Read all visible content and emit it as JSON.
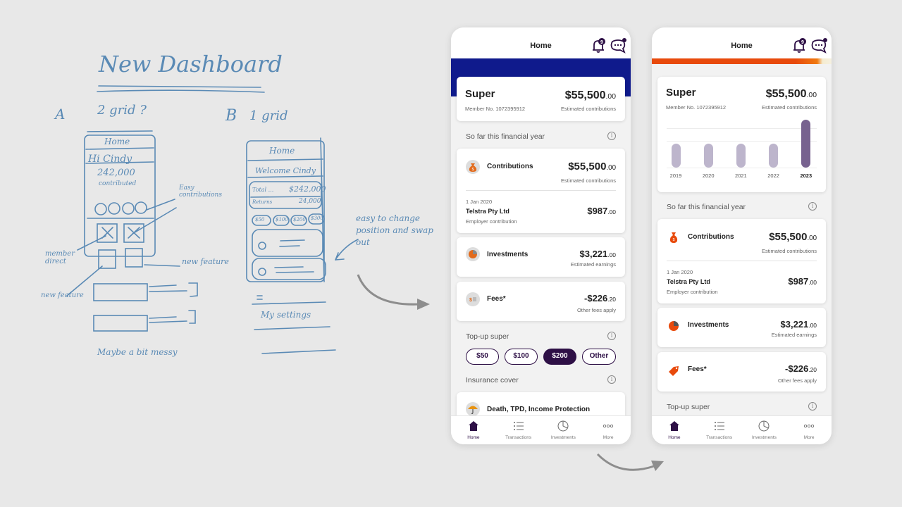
{
  "sketch": {
    "title": "New Dashboard",
    "option_a_label": "A",
    "option_a_desc": "2 grid ?",
    "option_b_label": "B",
    "option_b_desc": "1 grid",
    "a_phone": {
      "header": "Home",
      "greeting": "Hi Cindy",
      "amount": "242,000",
      "amount_caption": "contributed"
    },
    "b_phone": {
      "header": "Home",
      "greeting": "Welcome Cindy",
      "total_label": "Total ...",
      "total_value": "$242,000",
      "returns_label": "Returns",
      "returns_value": "24,000",
      "pills": [
        "$50",
        "$100",
        "$200",
        "$300"
      ],
      "settings": "My settings"
    },
    "annotations": {
      "easy_contributions": "Easy contributions",
      "member_direct": "member direct",
      "new_feature_1": "new feature",
      "new_feature_2": "new feature",
      "maybe_messy": "Maybe a bit messy",
      "easy_change": "easy to change position and swap out"
    }
  },
  "phones": [
    {
      "variant": "navy",
      "header": {
        "title": "Home",
        "notification_count": "9"
      },
      "accent_band_color": "#0f1a8c",
      "super": {
        "title": "Super",
        "member_no": "Member No. 1072395912",
        "amount_main": "$55,500",
        "amount_cents": ".00",
        "amount_caption": "Estimated contributions"
      },
      "section_financial": "So far this financial year",
      "contributions": {
        "label": "Contributions",
        "amount_main": "$55,500",
        "amount_cents": ".00",
        "caption": "Estimated contributions",
        "tx_date": "1 Jan 2020",
        "tx_name": "Telstra Pty Ltd",
        "tx_type": "Employer contribution",
        "tx_amount_main": "$987",
        "tx_amount_cents": ".00"
      },
      "investments": {
        "label": "Investments",
        "amount_main": "$3,221",
        "amount_cents": ".00",
        "caption": "Estimated earnings"
      },
      "fees": {
        "label": "Fees*",
        "amount_main": "-$226",
        "amount_cents": ".20",
        "caption": "Other fees apply"
      },
      "section_topup": "Top-up super",
      "topup_options": [
        {
          "label": "$50",
          "selected": false
        },
        {
          "label": "$100",
          "selected": false
        },
        {
          "label": "$200",
          "selected": true
        },
        {
          "label": "Other",
          "selected": false
        }
      ],
      "section_insurance": "Insurance cover",
      "insurance": {
        "label": "Death, TPD, Income Protection"
      },
      "tabs": [
        {
          "label": "Home",
          "icon": "home-icon",
          "active": true
        },
        {
          "label": "Transactions",
          "icon": "list-icon",
          "active": false
        },
        {
          "label": "Investments",
          "icon": "pie-chart-icon",
          "active": false
        },
        {
          "label": "More",
          "icon": "more-icon",
          "active": false
        }
      ]
    },
    {
      "variant": "orange",
      "header": {
        "title": "Home",
        "notification_count": "9"
      },
      "accent_band_color": "#e84a0c",
      "super": {
        "title": "Super",
        "member_no": "Member No. 1072395912",
        "amount_main": "$55,500",
        "amount_cents": ".00",
        "amount_caption": "Estimated contributions"
      },
      "section_financial": "So far this financial year",
      "contributions": {
        "label": "Contributions",
        "amount_main": "$55,500",
        "amount_cents": ".00",
        "caption": "Estimated contributions",
        "tx_date": "1 Jan 2020",
        "tx_name": "Telstra Pty Ltd",
        "tx_type": "Employer contribution",
        "tx_amount_main": "$987",
        "tx_amount_cents": ".00"
      },
      "investments": {
        "label": "Investments",
        "amount_main": "$3,221",
        "amount_cents": ".00",
        "caption": "Estimated earnings"
      },
      "fees": {
        "label": "Fees*",
        "amount_main": "-$226",
        "amount_cents": ".20",
        "caption": "Other fees apply"
      },
      "section_topup": "Top-up super",
      "tabs": [
        {
          "label": "Home",
          "icon": "home-icon",
          "active": true
        },
        {
          "label": "Transactions",
          "icon": "list-icon",
          "active": false
        },
        {
          "label": "Investments",
          "icon": "pie-chart-icon",
          "active": false
        },
        {
          "label": "More",
          "icon": "more-icon",
          "active": false
        }
      ]
    }
  ],
  "chart_data": {
    "type": "bar",
    "title": "",
    "categories": [
      "2019",
      "2020",
      "2021",
      "2022",
      "2023"
    ],
    "values": [
      1,
      1,
      1,
      1,
      2
    ],
    "highlighted": "2023",
    "xlabel": "",
    "ylabel": "",
    "ylim": [
      0,
      2
    ],
    "grid": true,
    "colors": {
      "default": "#bdb5cc",
      "highlight": "#77628f"
    }
  },
  "colors": {
    "brand_purple": "#2e1046",
    "navy_band": "#0f1a8c",
    "orange_band": "#e84a0c",
    "icon_orange": "#e26a1b"
  }
}
